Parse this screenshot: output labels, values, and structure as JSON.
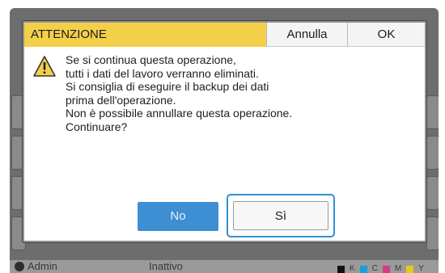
{
  "dialog": {
    "title": "ATTENZIONE",
    "cancel_label": "Annulla",
    "ok_label": "OK",
    "message_lines": [
      "Se si continua questa operazione,",
      "tutti i dati del lavoro verranno eliminati.",
      "Si consiglia di eseguire il backup dei dati",
      "prima dell'operazione.",
      "Non è possibile annullare questa operazione.",
      "Continuare?"
    ],
    "no_label": "No",
    "yes_label": "Sì",
    "icon": "warning-icon",
    "colors": {
      "title_bg": "#f4d04a",
      "no_button": "#3d8ed3",
      "focus_ring": "#2f90d6"
    }
  },
  "statusbar": {
    "user": "Admin",
    "state": "Inattivo",
    "ink_labels": [
      "K",
      "C",
      "M",
      "Y"
    ],
    "ink_colors": [
      "#111111",
      "#19a0d8",
      "#d43a8a",
      "#e8c81c"
    ]
  }
}
